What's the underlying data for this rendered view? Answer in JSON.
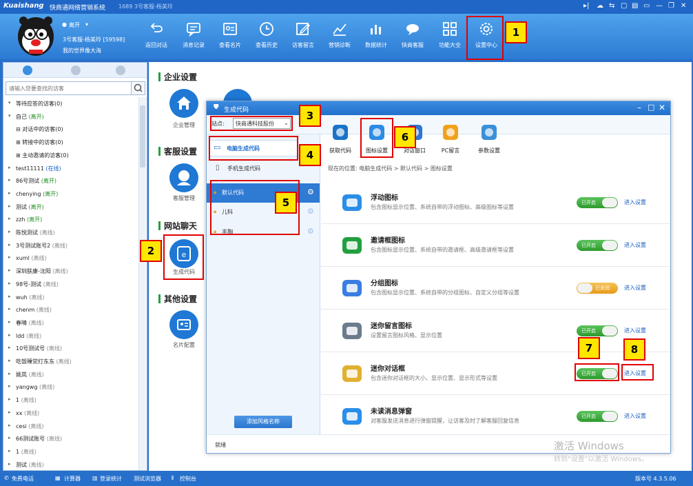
{
  "window": {
    "logo": "Kuaishang",
    "app_title": "快商通网络营销系统",
    "subtitle": "1689 3号客服-杨美玲",
    "controls": [
      "▸|",
      "☁",
      "⇆",
      "▢",
      "▤",
      "▭",
      "—",
      "❐",
      "✕"
    ]
  },
  "user": {
    "status": "离开",
    "name": "3号客服-杨美玲 [59598]",
    "motto": "我的世界像大海"
  },
  "toolbar": [
    {
      "label": "返回对话",
      "icon": "back-arrow-icon"
    },
    {
      "label": "消息记录",
      "icon": "message-icon"
    },
    {
      "label": "查看名片",
      "icon": "card-icon"
    },
    {
      "label": "查看历史",
      "icon": "clock-icon"
    },
    {
      "label": "访客留言",
      "icon": "edit-icon"
    },
    {
      "label": "营销诊断",
      "icon": "diagnosis-icon"
    },
    {
      "label": "数据统计",
      "icon": "bar-chart-icon"
    },
    {
      "label": "快商客服",
      "icon": "chat-bird-icon"
    },
    {
      "label": "功能大全",
      "icon": "grid-icon"
    },
    {
      "label": "设置中心",
      "icon": "gear-icon"
    }
  ],
  "sidebar": {
    "search_placeholder": "请输入您要查找的访客",
    "visitors": [
      {
        "text": "等待应答的访客(0)",
        "status": "",
        "arrow": "▾"
      },
      {
        "text": "自己",
        "status": "(离开)",
        "tone": "on",
        "arrow": "▾"
      },
      {
        "text": "⊟ 对话中的访客(0)",
        "status": "",
        "arrow": ""
      },
      {
        "text": "⊞ 转接中的访客(0)",
        "status": "",
        "arrow": ""
      },
      {
        "text": "⊞ 主动邀请的访客(0)",
        "status": "",
        "arrow": ""
      },
      {
        "text": "test11111",
        "status": "(在线)",
        "tone": "live",
        "arrow": "▸"
      },
      {
        "text": "86号测试",
        "status": "(离开)",
        "tone": "on",
        "arrow": "▸"
      },
      {
        "text": "chenying",
        "status": "(离开)",
        "tone": "on",
        "arrow": "▸"
      },
      {
        "text": "测试",
        "status": "(离开)",
        "tone": "on",
        "arrow": "▸"
      },
      {
        "text": "zzh",
        "status": "(离开)",
        "tone": "on",
        "arrow": "▸"
      },
      {
        "text": "陈悦测试",
        "status": "(离线)",
        "tone": "off",
        "arrow": "▸"
      },
      {
        "text": "3号测试账号2",
        "status": "(离线)",
        "tone": "off",
        "arrow": "▸"
      },
      {
        "text": "xuml",
        "status": "(离线)",
        "tone": "off",
        "arrow": "▸"
      },
      {
        "text": "深圳肤康-沈阳",
        "status": "(离线)",
        "tone": "off",
        "arrow": "▸"
      },
      {
        "text": "98号-测试",
        "status": "(离线)",
        "tone": "off",
        "arrow": "▸"
      },
      {
        "text": "wuh",
        "status": "(离线)",
        "tone": "off",
        "arrow": "▸"
      },
      {
        "text": "chenm",
        "status": "(离线)",
        "tone": "off",
        "arrow": "▸"
      },
      {
        "text": "春晴",
        "status": "(离线)",
        "tone": "off",
        "arrow": "▸"
      },
      {
        "text": "ldd",
        "status": "(离线)",
        "tone": "off",
        "arrow": "▸"
      },
      {
        "text": "10号测试号",
        "status": "(离线)",
        "tone": "off",
        "arrow": "▸"
      },
      {
        "text": "吃饭睡觉打东东",
        "status": "(离线)",
        "tone": "off",
        "arrow": "▸"
      },
      {
        "text": "姚岚",
        "status": "(离线)",
        "tone": "off",
        "arrow": "▸"
      },
      {
        "text": "yangwg",
        "status": "(离线)",
        "tone": "off",
        "arrow": "▸"
      },
      {
        "text": "1",
        "status": "(离线)",
        "tone": "off",
        "arrow": "▸"
      },
      {
        "text": "xx",
        "status": "(离线)",
        "tone": "off",
        "arrow": "▸"
      },
      {
        "text": "cesi",
        "status": "(离线)",
        "tone": "off",
        "arrow": "▸"
      },
      {
        "text": "66测试账号",
        "status": "(离线)",
        "tone": "off",
        "arrow": "▸"
      },
      {
        "text": "1",
        "status": "(离线)",
        "tone": "off",
        "arrow": "▸"
      },
      {
        "text": "测试",
        "status": "(离线)",
        "tone": "off",
        "arrow": "▸"
      }
    ]
  },
  "settings": {
    "sections": {
      "enterprise": "企业设置",
      "service": "客服设置",
      "website": "网站聊天",
      "other": "其他设置"
    },
    "items": {
      "enterprise_mgmt": "企业管理",
      "service_mgmt": "客服管理",
      "gen_code": "生成代码",
      "card_config": "名片配置"
    }
  },
  "dialog": {
    "title": "生成代码",
    "site_label": "站点:",
    "site_value": "快商通科技股份",
    "pc_code": "电脑生成代码",
    "mobile_code": "手机生成代码",
    "styles": [
      "默认代码",
      "儿科",
      "丰胸"
    ],
    "add_style": "添加风格名称",
    "tools": [
      "获取代码",
      "图标设置",
      "对话窗口",
      "PC留言",
      "参数设置"
    ],
    "breadcrumb": "现在的位置: 电脑生成代码 > 默认代码 > 图标设置",
    "status": "就绪",
    "rows": [
      {
        "name": "浮动图标",
        "desc": "包含图标显示位置、系统自带的浮动图标、高级图标等设置",
        "toggle": "已开启",
        "on": true,
        "enter": "进入设置"
      },
      {
        "name": "邀请框图标",
        "desc": "包含图标显示位置、系统自带的邀请框、高级邀请框等设置",
        "toggle": "已开启",
        "on": true,
        "enter": "进入设置"
      },
      {
        "name": "分组图标",
        "desc": "包含图标显示位置、系统自带的分组图标、自定义分组等设置",
        "toggle": "已关闭",
        "on": false,
        "enter": "进入设置"
      },
      {
        "name": "迷你留言图标",
        "desc": "设置留言图标风格、显示位置",
        "toggle": "已开启",
        "on": true,
        "enter": "进入设置"
      },
      {
        "name": "迷你对话框",
        "desc": "包含迷你对话框的大小、显示位置、显示形式等设置",
        "toggle": "已开启",
        "on": true,
        "enter": "进入设置"
      },
      {
        "name": "未读消息弹窗",
        "desc": "对客服发送消息进行弹窗提醒，让访客及时了解客服回复信息",
        "toggle": "已开启",
        "on": true,
        "enter": "进入设置"
      }
    ]
  },
  "bottombar": {
    "items": [
      "免费电话",
      "计算器",
      "登录统计",
      "测试浏览器",
      "控制台"
    ],
    "version": "版本号 4.3.5.06"
  },
  "watermark": {
    "line1": "激活 Windows",
    "line2": "转到\"设置\"以激活 Windows。"
  },
  "callouts": [
    "1",
    "2",
    "3",
    "4",
    "5",
    "6",
    "7",
    "8"
  ],
  "colors": {
    "brand_blue": "#1f66c6",
    "toggle_on": "#2e9a2e",
    "toggle_off": "#e69a1a",
    "callout_fill": "#ffe600",
    "callout_border": "#e00000"
  }
}
